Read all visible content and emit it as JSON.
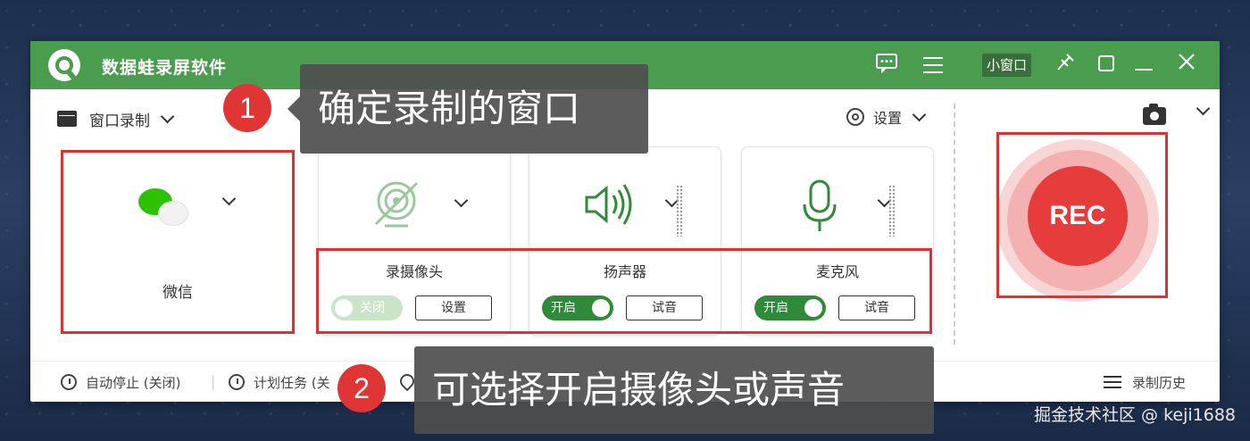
{
  "app": {
    "title": "数据蛙录屏软件",
    "mini_window_label": "小窗口"
  },
  "toolbar": {
    "mode_label": "窗口录制",
    "settings_label": "设置"
  },
  "target": {
    "label": "微信"
  },
  "devices": [
    {
      "name": "录摄像头",
      "toggle_label": "关闭",
      "enabled": false,
      "action_label": "设置"
    },
    {
      "name": "扬声器",
      "toggle_label": "开启",
      "enabled": true,
      "action_label": "试音"
    },
    {
      "name": "麦克风",
      "toggle_label": "开启",
      "enabled": true,
      "action_label": "试音"
    }
  ],
  "rec": {
    "label": "REC"
  },
  "bottom": {
    "auto_stop": "自动停止 (关闭)",
    "schedule": "计划任务 (关",
    "history": "录制历史"
  },
  "callouts": [
    {
      "number": "1",
      "text": "确定录制的窗口"
    },
    {
      "number": "2",
      "text": "可选择开启摄像头或声音"
    }
  ],
  "watermark": "掘金技术社区 @ keji1688",
  "colors": {
    "titlebar": "#4a9c4e",
    "rec": "#e63c3c",
    "highlight": "#e03030",
    "toggle_on": "#2f8a3a"
  }
}
